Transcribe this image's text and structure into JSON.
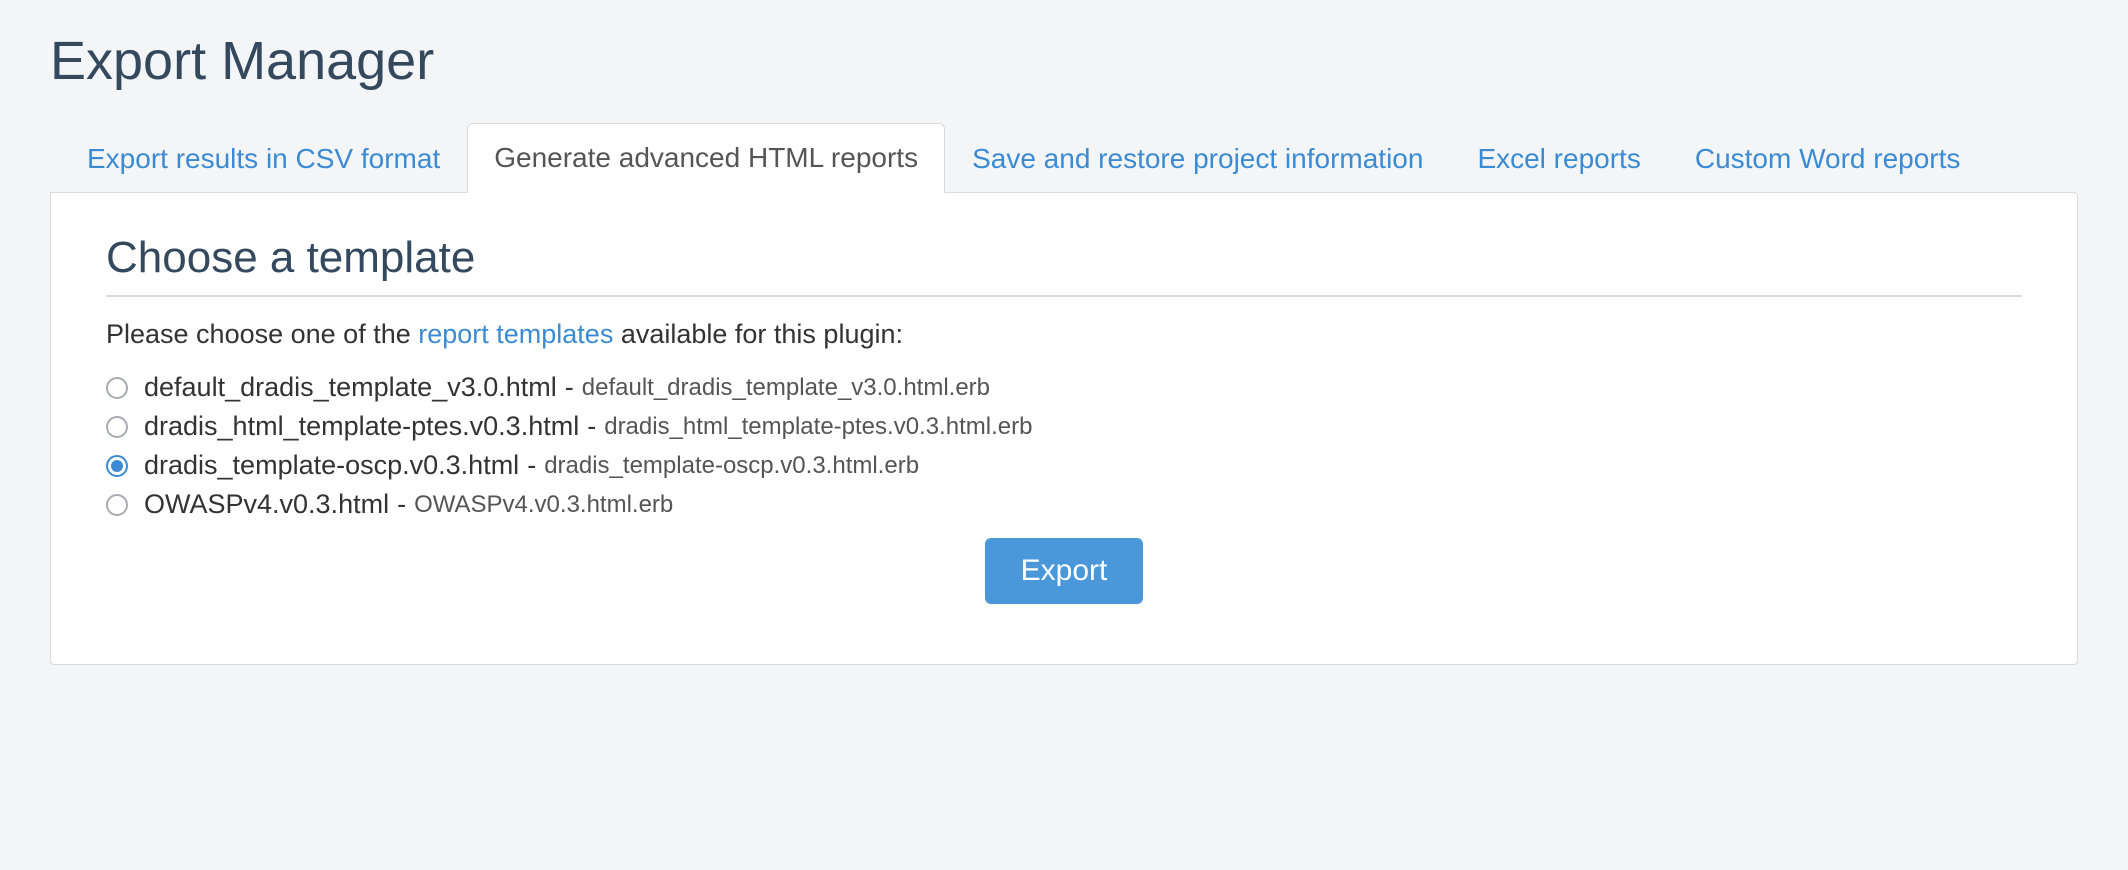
{
  "page": {
    "title": "Export Manager"
  },
  "tabs": [
    {
      "label": "Export results in CSV format",
      "active": false
    },
    {
      "label": "Generate advanced HTML reports",
      "active": true
    },
    {
      "label": "Save and restore project information",
      "active": false
    },
    {
      "label": "Excel reports",
      "active": false
    },
    {
      "label": "Custom Word reports",
      "active": false
    }
  ],
  "section": {
    "heading": "Choose a template",
    "instruction_pre": "Please choose one of the ",
    "instruction_link": "report templates",
    "instruction_post": " available for this plugin:"
  },
  "templates": [
    {
      "label": "default_dradis_template_v3.0.html",
      "file": "default_dradis_template_v3.0.html.erb",
      "selected": false
    },
    {
      "label": "dradis_html_template-ptes.v0.3.html",
      "file": "dradis_html_template-ptes.v0.3.html.erb",
      "selected": false
    },
    {
      "label": "dradis_template-oscp.v0.3.html",
      "file": "dradis_template-oscp.v0.3.html.erb",
      "selected": true
    },
    {
      "label": "OWASPv4.v0.3.html",
      "file": "OWASPv4.v0.3.html.erb",
      "selected": false
    }
  ],
  "actions": {
    "export_label": "Export"
  }
}
